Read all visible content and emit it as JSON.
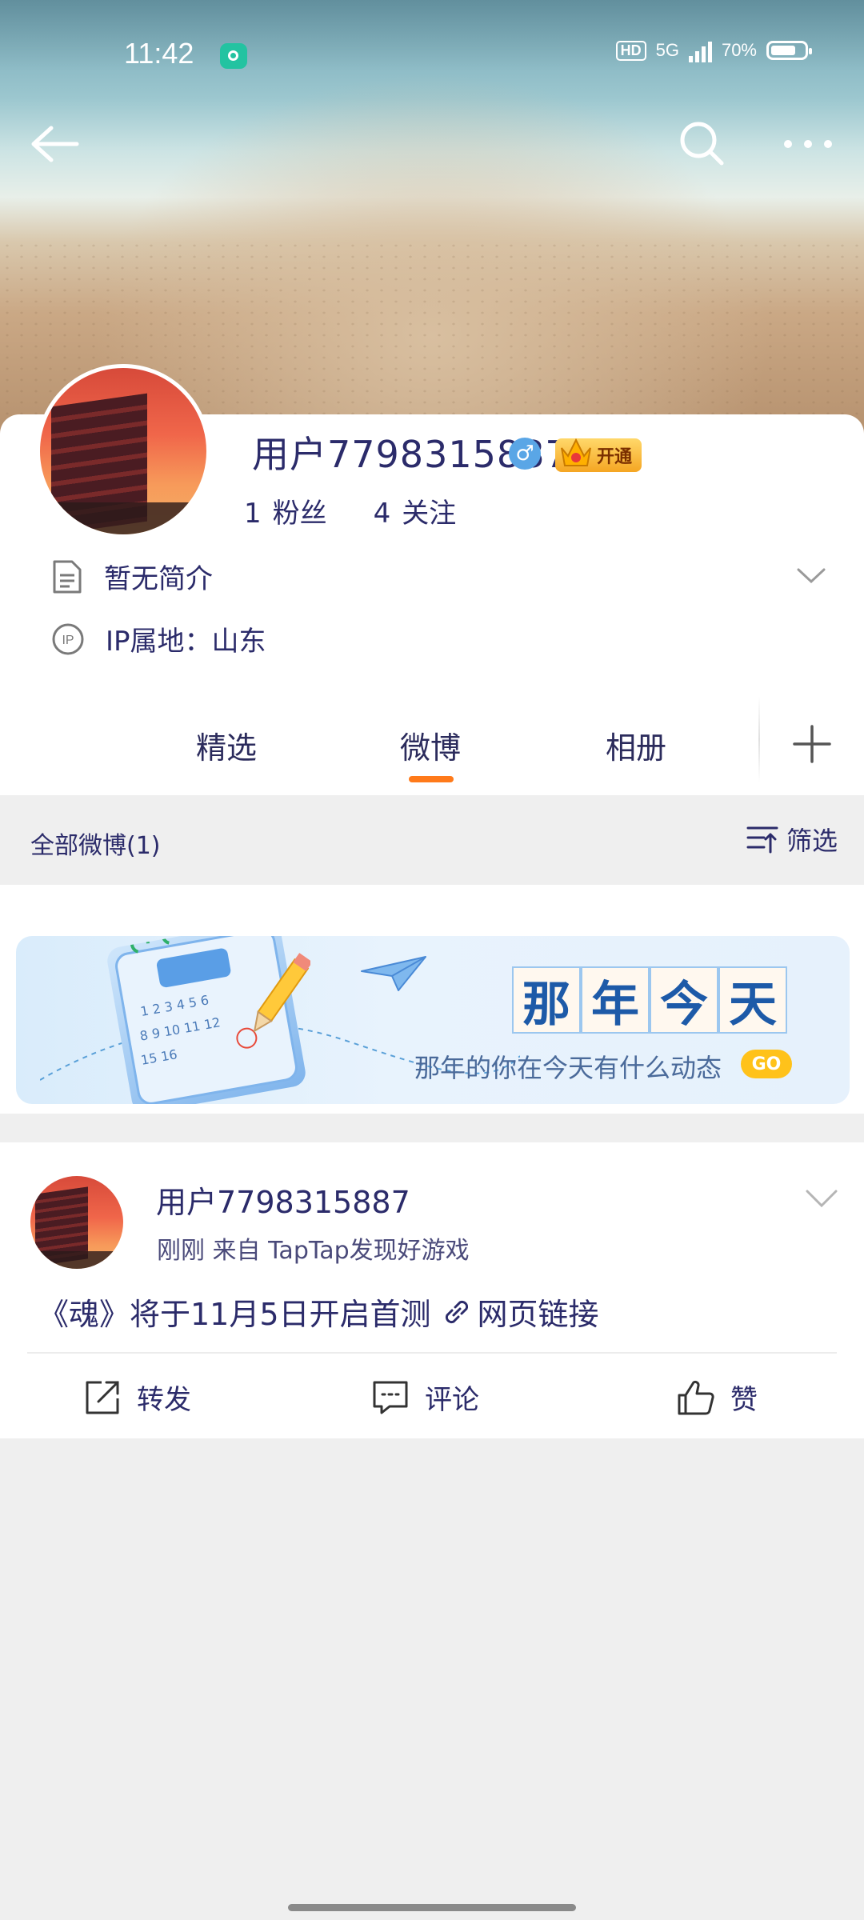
{
  "status_bar": {
    "time": "11:42",
    "hd": "HD",
    "network": "5G",
    "battery_percent": "70%"
  },
  "nav": {
    "back_icon": "back-arrow-icon",
    "search_icon": "search-icon",
    "more_icon": "more-dots-icon"
  },
  "profile": {
    "username": "用户7798315887",
    "gender_symbol": "♂",
    "vip_label": "开通",
    "followers_count": "1",
    "followers_label": "粉丝",
    "following_count": "4",
    "following_label": "关注",
    "bio": "暂无简介",
    "ip_badge": "IP",
    "ip_location": "IP属地：山东"
  },
  "tabs": {
    "items": [
      {
        "label": "精选"
      },
      {
        "label": "微博"
      },
      {
        "label": "相册"
      }
    ],
    "active_index": 1
  },
  "filter_bar": {
    "all_posts": "全部微博(1)",
    "filter_label": "筛选"
  },
  "banner": {
    "title_chars": [
      "那",
      "年",
      "今",
      "天"
    ],
    "subtitle": "那年的你在今天有什么动态",
    "go_label": "GO"
  },
  "post": {
    "username": "用户7798315887",
    "meta": "刚刚  来自 TapTap发现好游戏",
    "content": "《魂》将于11月5日开启首测",
    "link_label": "网页链接",
    "repost_label": "转发",
    "comment_label": "评论",
    "like_label": "赞"
  },
  "colors": {
    "accent": "#ff7a1a",
    "text": "#2b2b6a",
    "page_bg": "#efefef",
    "vip_gold": "#f5a623",
    "gender_blue": "#5aa6e6"
  }
}
